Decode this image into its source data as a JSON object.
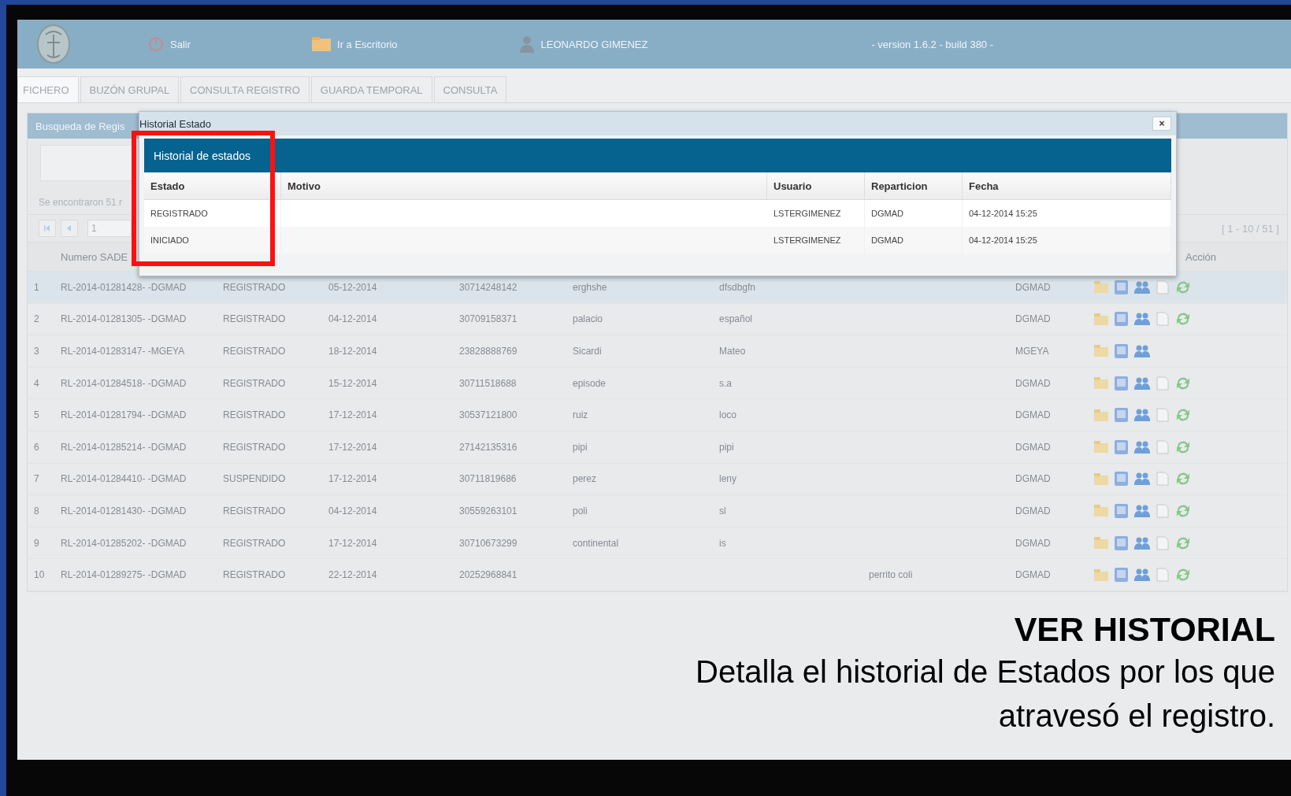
{
  "header": {
    "items": [
      {
        "kind": "power",
        "label": "Salir"
      },
      {
        "kind": "folder",
        "label": "Ir a Escritorio"
      },
      {
        "kind": "user",
        "label": "LEONARDO GIMENEZ"
      }
    ],
    "version": "- version 1.6.2 - build 380 -"
  },
  "tabs": [
    {
      "label": "FICHERO",
      "selected": true
    },
    {
      "label": "BUZÓN GRUPAL",
      "selected": false
    },
    {
      "label": "CONSULTA REGISTRO",
      "selected": false
    },
    {
      "label": "GUARDA TEMPORAL",
      "selected": false
    },
    {
      "label": "CONSULTA",
      "selected": false
    }
  ],
  "panel": {
    "title": "Busqueda de Regis",
    "found": "Se encontraron 51 r",
    "page": "1",
    "range": "[ 1 - 10 / 51 ]"
  },
  "table": {
    "column_headers": {
      "number": "Numero SADE",
      "actions": "Acción"
    },
    "rows": [
      {
        "index": "1",
        "sade": "RL-2014-01281428- -DGMAD",
        "estado": "REGISTRADO",
        "fecha": "05-12-2014",
        "cuit": "30714248142",
        "column_6": "erghshe",
        "column_7": "dfsdbgfn",
        "reparticion": "DGMAD",
        "selected": true,
        "actions": [
          {
            "kind": "folder"
          },
          {
            "kind": "note"
          },
          {
            "kind": "users"
          },
          {
            "kind": "document"
          },
          {
            "kind": "refresh"
          }
        ]
      },
      {
        "index": "2",
        "sade": "RL-2014-01281305- -DGMAD",
        "estado": "REGISTRADO",
        "fecha": "04-12-2014",
        "cuit": "30709158371",
        "column_6": "palacio",
        "column_7": "español",
        "reparticion": "DGMAD",
        "selected": false,
        "actions": [
          {
            "kind": "folder"
          },
          {
            "kind": "note"
          },
          {
            "kind": "users"
          },
          {
            "kind": "document"
          },
          {
            "kind": "refresh"
          }
        ]
      },
      {
        "index": "3",
        "sade": "RL-2014-01283147- -MGEYA",
        "estado": "REGISTRADO",
        "fecha": "18-12-2014",
        "cuit": "23828888769",
        "column_6": "Sicardi",
        "column_7": "Mateo",
        "reparticion": "MGEYA",
        "selected": false,
        "actions": [
          {
            "kind": "folder"
          },
          {
            "kind": "note"
          },
          {
            "kind": "users"
          }
        ]
      },
      {
        "index": "4",
        "sade": "RL-2014-01284518- -DGMAD",
        "estado": "REGISTRADO",
        "fecha": "15-12-2014",
        "cuit": "30711518688",
        "column_6": "episode",
        "column_7": "s.a",
        "reparticion": "DGMAD",
        "selected": false,
        "actions": [
          {
            "kind": "folder"
          },
          {
            "kind": "note"
          },
          {
            "kind": "users"
          },
          {
            "kind": "document"
          },
          {
            "kind": "refresh"
          }
        ]
      },
      {
        "index": "5",
        "sade": "RL-2014-01281794- -DGMAD",
        "estado": "REGISTRADO",
        "fecha": "17-12-2014",
        "cuit": "30537121800",
        "column_6": "ruiz",
        "column_7": "loco",
        "reparticion": "DGMAD",
        "selected": false,
        "actions": [
          {
            "kind": "folder"
          },
          {
            "kind": "note"
          },
          {
            "kind": "users"
          },
          {
            "kind": "document"
          },
          {
            "kind": "refresh"
          }
        ]
      },
      {
        "index": "6",
        "sade": "RL-2014-01285214- -DGMAD",
        "estado": "REGISTRADO",
        "fecha": "17-12-2014",
        "cuit": "27142135316",
        "column_6": "pipi",
        "column_7": "pipi",
        "reparticion": "DGMAD",
        "selected": false,
        "actions": [
          {
            "kind": "folder"
          },
          {
            "kind": "note"
          },
          {
            "kind": "users"
          },
          {
            "kind": "document"
          },
          {
            "kind": "refresh"
          }
        ]
      },
      {
        "index": "7",
        "sade": "RL-2014-01284410- -DGMAD",
        "estado": "SUSPENDIDO",
        "fecha": "17-12-2014",
        "cuit": "30711819686",
        "column_6": "perez",
        "column_7": "leny",
        "reparticion": "DGMAD",
        "selected": false,
        "actions": [
          {
            "kind": "folder"
          },
          {
            "kind": "note"
          },
          {
            "kind": "users"
          },
          {
            "kind": "document"
          },
          {
            "kind": "refresh"
          }
        ]
      },
      {
        "index": "8",
        "sade": "RL-2014-01281430- -DGMAD",
        "estado": "REGISTRADO",
        "fecha": "04-12-2014",
        "cuit": "30559263101",
        "column_6": "poli",
        "column_7": "sl",
        "reparticion": "DGMAD",
        "selected": false,
        "actions": [
          {
            "kind": "folder"
          },
          {
            "kind": "note"
          },
          {
            "kind": "users"
          },
          {
            "kind": "document"
          },
          {
            "kind": "refresh"
          }
        ]
      },
      {
        "index": "9",
        "sade": "RL-2014-01285202- -DGMAD",
        "estado": "REGISTRADO",
        "fecha": "17-12-2014",
        "cuit": "30710673299",
        "column_6": "continental",
        "column_7": "is",
        "reparticion": "DGMAD",
        "selected": false,
        "actions": [
          {
            "kind": "folder"
          },
          {
            "kind": "note"
          },
          {
            "kind": "users"
          },
          {
            "kind": "document"
          },
          {
            "kind": "refresh"
          }
        ]
      },
      {
        "index": "10",
        "sade": "RL-2014-01289275- -DGMAD",
        "estado": "REGISTRADO",
        "fecha": "22-12-2014",
        "cuit": "20252968841",
        "column_8": "perrito coli",
        "reparticion": "DGMAD",
        "selected": false,
        "actions": [
          {
            "kind": "folder"
          },
          {
            "kind": "note"
          },
          {
            "kind": "users"
          },
          {
            "kind": "document"
          },
          {
            "kind": "refresh"
          }
        ]
      }
    ]
  },
  "modal": {
    "title": "Historial Estado",
    "close": "×",
    "heading": "Historial de estados",
    "columns": [
      "Estado",
      "Motivo",
      "Usuario",
      "Reparticion",
      "Fecha"
    ],
    "rows": [
      {
        "estado": "REGISTRADO",
        "usuario": "LSTERGIMENEZ",
        "reparticion": "DGMAD",
        "fecha": "04-12-2014 15:25"
      },
      {
        "estado": "INICIADO",
        "usuario": "LSTERGIMENEZ",
        "reparticion": "DGMAD",
        "fecha": "04-12-2014 15:25"
      }
    ]
  },
  "caption": {
    "title": "VER HISTORIAL",
    "text": "Detalla el historial de Estados por los que atravesó el registro."
  }
}
